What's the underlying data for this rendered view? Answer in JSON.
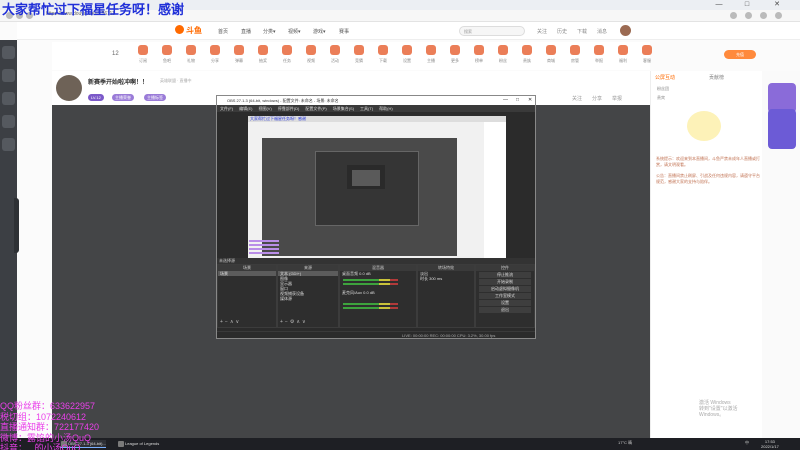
{
  "stream_banner": "大家帮忙过下福星任务呀！感谢",
  "browser": {
    "url": "https://www.douyu.com/156111",
    "win_controls": [
      "—",
      "□",
      "✕"
    ]
  },
  "site": {
    "logo": "斗鱼",
    "nav": [
      "首页",
      "直播",
      "分类▾",
      "视频▾",
      "游戏▾",
      "赛事"
    ],
    "search_placeholder": "搜索",
    "header_icons": [
      "关注",
      "历史",
      "下载",
      "消息"
    ]
  },
  "toolbar": {
    "count": "12",
    "items": [
      "订阅",
      "鱼吧",
      "礼物",
      "分享",
      "弹幕",
      "抽奖",
      "任务",
      "视频",
      "活动",
      "竞猜",
      "下载",
      "设置",
      "主播",
      "更多",
      "榜单",
      "粉丝",
      "贵族",
      "商城",
      "房管",
      "举报",
      "福利",
      "客服"
    ],
    "charge_label": "充值"
  },
  "room": {
    "title": "新赛季开始啦冲啊！！",
    "subtitle": "英雄联盟 · 直播中",
    "tags": [
      "LV.12",
      "主播荣誉",
      "主播标签"
    ],
    "actions": [
      "关注",
      "分享",
      "举报"
    ]
  },
  "obs": {
    "title": "OBS 27.1.3 (64-bit, windows) - 配置文件: 未命名 - 场景: 未命名",
    "menu": [
      "文件(F)",
      "编辑(E)",
      "视图(V)",
      "停靠部件(D)",
      "配置文件(P)",
      "场景集合(S)",
      "工具(T)",
      "帮助(H)"
    ],
    "inner_title": "大家帮忙过下福星任务呀！感谢",
    "scene_label": "未选择源",
    "docks": [
      {
        "title": "场景",
        "rows": [
          "场景"
        ]
      },
      {
        "title": "来源",
        "rows": [
          "文本 (GDI+)",
          "图像",
          "显示器",
          "窗口",
          "视频捕获设备",
          "媒体源"
        ]
      },
      {
        "title": "混音器",
        "rows": [
          "桌面音频 0.0 dB",
          "麦克风/Aux 0.0 dB"
        ]
      },
      {
        "title": "转场特效",
        "rows": [
          "淡出",
          "时长 300 ms"
        ]
      },
      {
        "title": "控件",
        "rows": [
          "停止推流",
          "开始录制",
          "启动虚拟摄像机",
          "工作室模式",
          "设置",
          "退出"
        ]
      }
    ],
    "status": "LIVE: 00:00:00   REC: 00:00:00   CPU: 3.2%, 30.00 fps"
  },
  "chat": {
    "tabs": [
      "公屏互动",
      "贡献榜"
    ],
    "rows": [
      "粉丝团",
      "贵宾"
    ],
    "messages": [
      "系统提示：欢迎来到本直播间，斗鱼严禁未成年人直播或打赏，请文明观看。",
      "公告：直播间禁止刷屏、引战及任何违规内容，请遵守平台规范，感谢大家的支持与陪伴。"
    ],
    "watermark_line1": "激活 Windows",
    "watermark_line2": "转到\"设置\"以激活 Windows。"
  },
  "overlay": [
    "QQ粉丝群：633622957",
    "税切组：1072240612",
    "直播通知群：722177420",
    "微博：露馅的小汤QuQ",
    "抖音：...的小汤QuQ"
  ],
  "taskbar": {
    "items": [
      "OBS 27.1.3 (64-bit)...",
      "League of Legends"
    ],
    "weather": "17°C 晴",
    "ime": "中",
    "time": "17:53",
    "date": "2022/1/17"
  }
}
